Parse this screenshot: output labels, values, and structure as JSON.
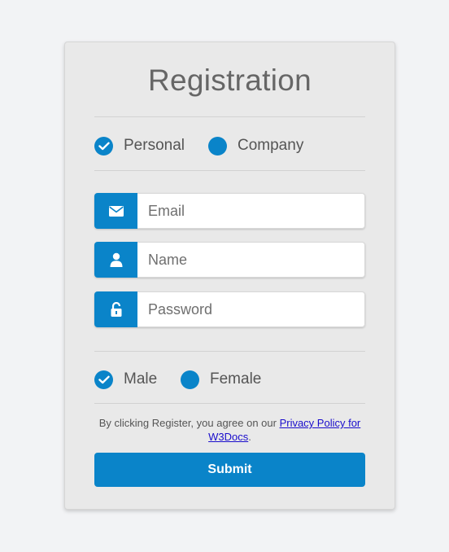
{
  "form": {
    "title": "Registration",
    "account_type": {
      "options": [
        {
          "label": "Personal",
          "checked": true
        },
        {
          "label": "Company",
          "checked": false
        }
      ]
    },
    "fields": {
      "email_placeholder": "Email",
      "name_placeholder": "Name",
      "password_placeholder": "Password"
    },
    "gender": {
      "options": [
        {
          "label": "Male",
          "checked": true
        },
        {
          "label": "Female",
          "checked": false
        }
      ]
    },
    "terms": {
      "prefix": "By clicking Register, you agree on our ",
      "link_text": "Privacy Policy for W3Docs",
      "suffix": "."
    },
    "submit_label": "Submit"
  },
  "colors": {
    "accent": "#0a84c9",
    "card_background": "#e9e9e9",
    "page_background": "#f2f3f5",
    "link": "#1a0dcc"
  },
  "icons": {
    "email": "envelope-icon",
    "name": "user-icon",
    "password": "unlock-icon",
    "checked": "check-icon"
  }
}
